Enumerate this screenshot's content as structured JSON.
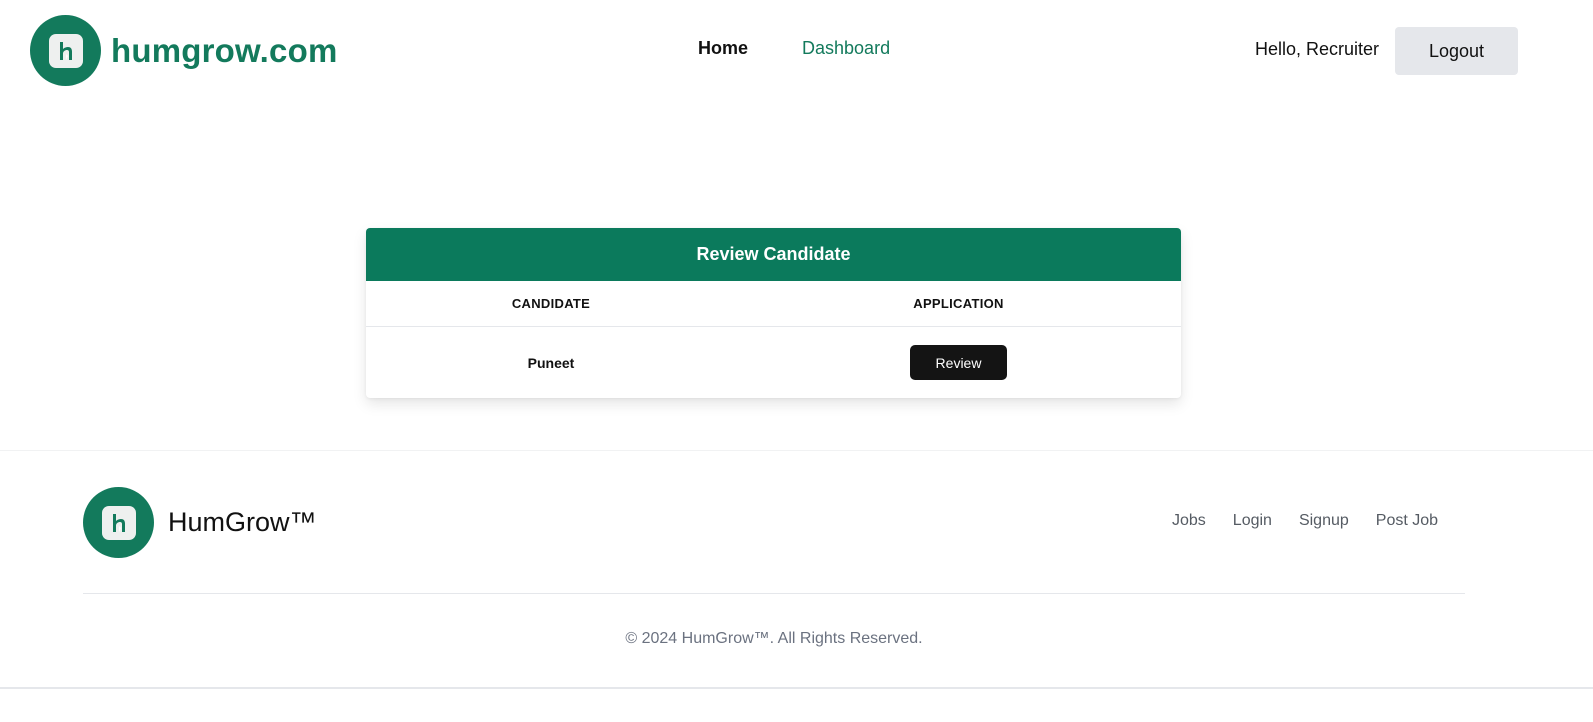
{
  "header": {
    "brand_name": "humgrow.com",
    "logo_icon": "leaf-h-logo-icon",
    "nav": {
      "home": "Home",
      "dashboard": "Dashboard"
    },
    "greeting": "Hello, Recruiter",
    "logout_label": "Logout"
  },
  "card": {
    "title": "Review Candidate",
    "columns": [
      "CANDIDATE",
      "APPLICATION"
    ],
    "rows": [
      {
        "candidate": "Puneet",
        "action_label": "Review"
      }
    ]
  },
  "footer": {
    "brand_name": "HumGrow™",
    "links": [
      "Jobs",
      "Login",
      "Signup",
      "Post Job"
    ],
    "copyright": "© 2024 HumGrow™. All Rights Reserved."
  },
  "colors": {
    "brand_green": "#137a5c",
    "card_header": "#0b7a5c",
    "button_dark": "#141414",
    "logout_bg": "#e5e7eb"
  }
}
